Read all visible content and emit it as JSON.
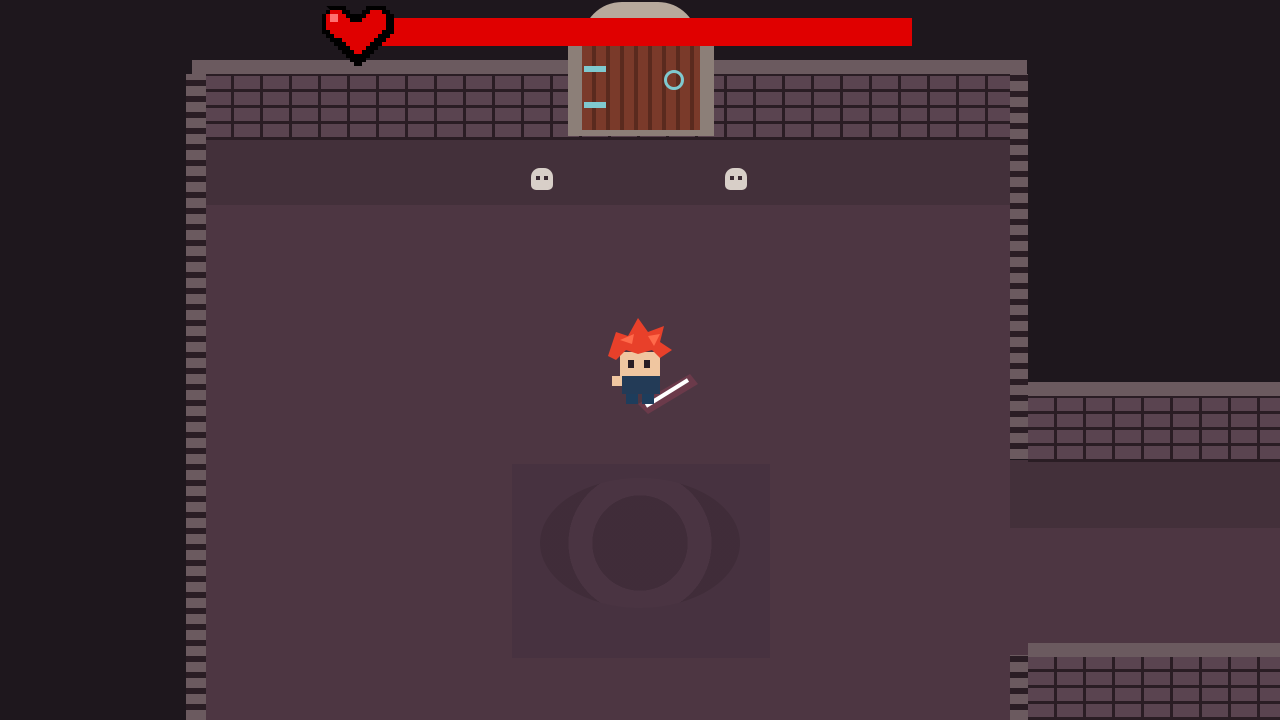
{
  "hud": {
    "health_fraction": 1.0,
    "heart_icon": "heart-icon",
    "colors": {
      "health": "#e00000",
      "heart": "#e00000"
    }
  },
  "scene": {
    "floor_color": "#4d3642",
    "skulls": 2,
    "door_icon": "wooden-door",
    "player_icon": "red-haired-hero-with-sword"
  }
}
